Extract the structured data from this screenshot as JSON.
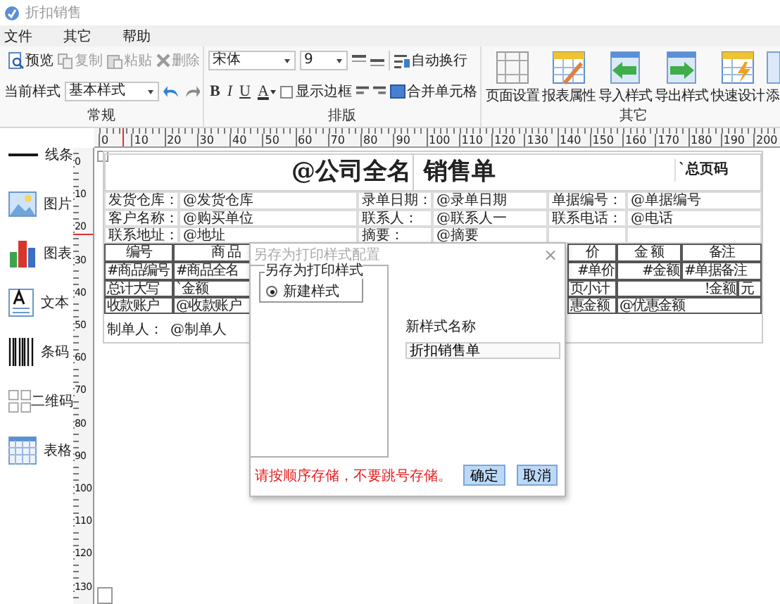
{
  "window": {
    "title": "折扣销售"
  },
  "menu": [
    "文件",
    "其它",
    "帮助"
  ],
  "ribbon": {
    "general": {
      "label": "常规",
      "buttons": [
        {
          "label": "预览",
          "disabled": false
        },
        {
          "label": "复制",
          "disabled": true
        },
        {
          "label": "粘贴",
          "disabled": true
        },
        {
          "label": "删除",
          "disabled": true
        }
      ],
      "style_label": "当前样式",
      "style_value": "基本样式"
    },
    "layout": {
      "label": "排版",
      "font": "宋体",
      "size": "9",
      "format": [
        "B",
        "I",
        "U",
        "A"
      ],
      "show_border": {
        "label": "显示边框",
        "checked": false
      },
      "wrap": "自动换行",
      "merge": "合并单元格"
    },
    "other": {
      "label": "其它",
      "buttons": [
        "页面设置",
        "报表属性",
        "导入样式",
        "导出样式",
        "快速设计",
        "添"
      ]
    }
  },
  "toolbox": [
    "线条",
    "图片",
    "图表",
    "文本",
    "条码",
    "二维码",
    "表格"
  ],
  "rulers": {
    "horizontal": [
      "0",
      "10",
      "20",
      "30",
      "40",
      "50",
      "60",
      "70",
      "80",
      "90",
      "100",
      "110",
      "120",
      "130",
      "140",
      "150",
      "160",
      "170",
      "180",
      "190",
      "200"
    ],
    "vertical": [
      "0",
      "10",
      "20",
      "30",
      "40",
      "50",
      "60",
      "70",
      "80",
      "90",
      "100",
      "110",
      "120",
      "130"
    ]
  },
  "report": {
    "title": [
      "@公司全名",
      "销售单"
    ],
    "page_count": "`总页码",
    "info_rows": [
      [
        "发货仓库：",
        "@发货仓库",
        "录单日期：",
        "@录单日期",
        "单据编号：",
        "@单据编号"
      ],
      [
        "客户名称：",
        "@购买单位",
        "联系人：",
        "@联系人一",
        "联系电话：",
        "@电话"
      ],
      [
        "联系地址：",
        "@地址",
        "摘要：",
        "@摘要"
      ]
    ],
    "table_rows": [
      [
        "编号",
        "商 品",
        "价",
        "金 额",
        "备注"
      ],
      [
        "#商品编号",
        "#商品全名",
        "#单价",
        "#金额",
        "#单据备注"
      ],
      [
        "总计大写",
        "`金额",
        "页小计",
        "!金额",
        "元"
      ],
      [
        "收款账户",
        "@收款账户",
        "惠金额",
        "@优惠金额"
      ]
    ],
    "footer": [
      "制单人：",
      "@制单人"
    ]
  },
  "dialog": {
    "title": "另存为打印样式配置",
    "close": "×",
    "group": "另存为打印样式",
    "options": [
      {
        "label": "新建样式",
        "selected": true
      }
    ],
    "name_label": "新样式名称",
    "name_value": "折扣销售单",
    "warning": "请按顺序存储，不要跳号存储。",
    "buttons": [
      "确定",
      "取消"
    ]
  }
}
